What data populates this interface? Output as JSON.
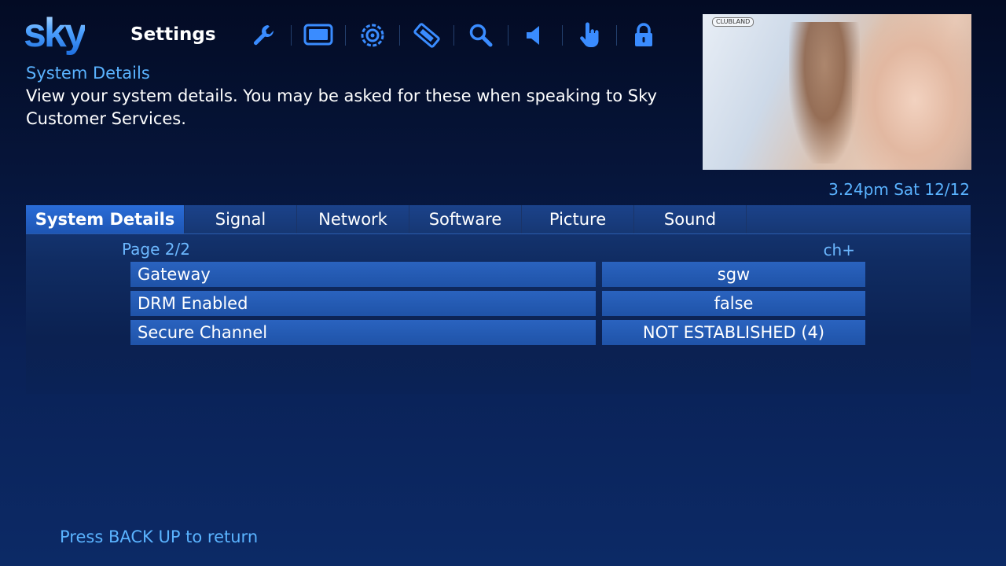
{
  "header": {
    "logo_text": "sky",
    "screen_title": "Settings",
    "icons": [
      {
        "name": "wrench-icon",
        "color": "#3a8cff"
      },
      {
        "name": "tv-screen-icon",
        "color": "#3a8cff"
      },
      {
        "name": "gear-ring-icon",
        "color": "#3a8cff"
      },
      {
        "name": "ticket-tag-icon",
        "color": "#3a8cff"
      },
      {
        "name": "search-icon",
        "color": "#3a8cff"
      },
      {
        "name": "speaker-icon",
        "color": "#3a8cff"
      },
      {
        "name": "hand-pointer-icon",
        "color": "#3a8cff"
      },
      {
        "name": "lock-icon",
        "color": "#3a8cff"
      }
    ]
  },
  "section": {
    "title": "System Details",
    "description": "View your system details. You may be asked for these when speaking to Sky Customer Services."
  },
  "preview": {
    "channel_bug": "CLUBLAND"
  },
  "clock": "3.24pm Sat 12/12",
  "tabs": [
    {
      "label": "System Details",
      "active": true
    },
    {
      "label": "Signal",
      "active": false
    },
    {
      "label": "Network",
      "active": false
    },
    {
      "label": "Software",
      "active": false
    },
    {
      "label": "Picture",
      "active": false
    },
    {
      "label": "Sound",
      "active": false
    }
  ],
  "table": {
    "page_indicator": "Page 2/2",
    "next_page_hint": "ch+",
    "rows": [
      {
        "label": "Gateway",
        "value": "sgw"
      },
      {
        "label": "DRM Enabled",
        "value": "false"
      },
      {
        "label": "Secure Channel",
        "value": "NOT ESTABLISHED (4)"
      }
    ]
  },
  "footer": {
    "hint": "Press BACK UP to return"
  },
  "colors": {
    "accent": "#5ab3ff",
    "row_fill": "#2a63bf",
    "active_tab": "#2a6cd8"
  }
}
